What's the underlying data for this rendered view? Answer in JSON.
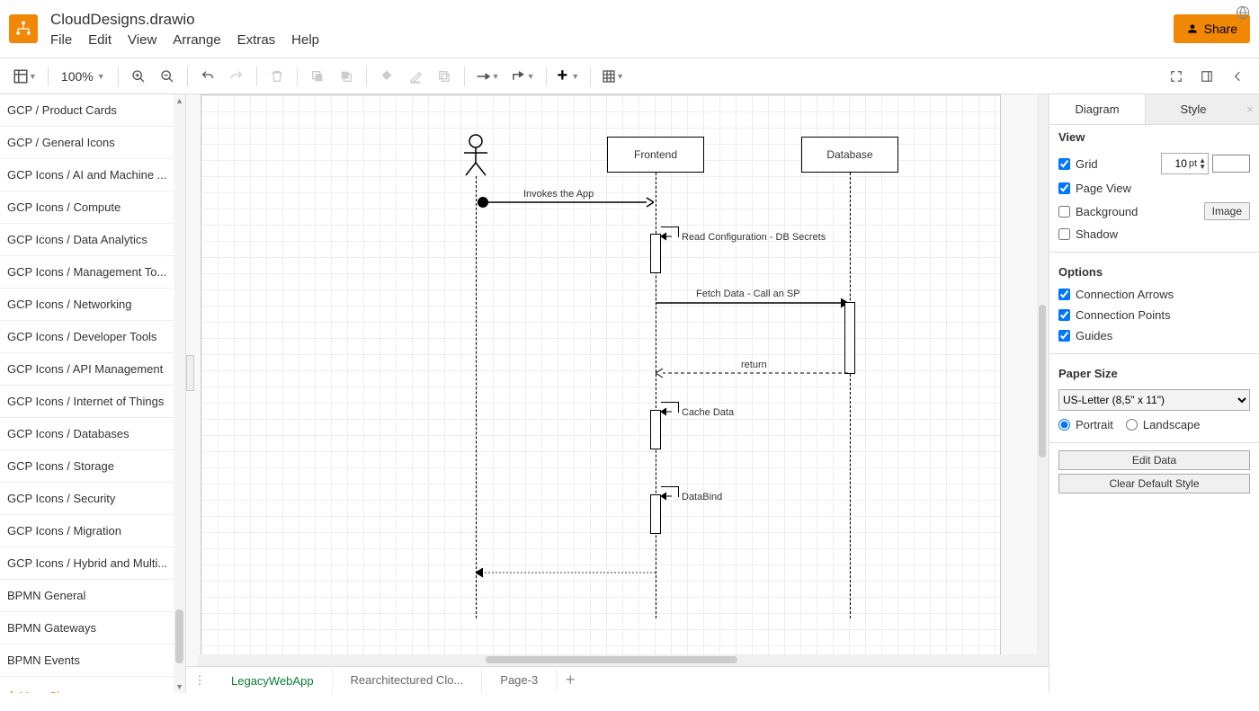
{
  "header": {
    "title": "CloudDesigns.drawio",
    "menus": [
      "File",
      "Edit",
      "View",
      "Arrange",
      "Extras",
      "Help"
    ],
    "share_label": "Share"
  },
  "toolbar": {
    "zoom": "100%"
  },
  "shapes": {
    "categories": [
      "GCP / Product Cards",
      "GCP / General Icons",
      "GCP Icons / AI and Machine ...",
      "GCP Icons / Compute",
      "GCP Icons / Data Analytics",
      "GCP Icons / Management To...",
      "GCP Icons / Networking",
      "GCP Icons / Developer Tools",
      "GCP Icons / API Management",
      "GCP Icons / Internet of Things",
      "GCP Icons / Databases",
      "GCP Icons / Storage",
      "GCP Icons / Security",
      "GCP Icons / Migration",
      "GCP Icons / Hybrid and Multi...",
      "BPMN General",
      "BPMN Gateways",
      "BPMN Events"
    ],
    "more_shapes": "More Shapes..."
  },
  "tabs": {
    "items": [
      "LegacyWebApp",
      "Rearchitectured Clo...",
      "Page-3"
    ],
    "active": 0
  },
  "right_panel": {
    "tabs": {
      "diagram": "Diagram",
      "style": "Style"
    },
    "view_heading": "View",
    "grid": "Grid",
    "grid_value": "10",
    "grid_unit": "pt",
    "page_view": "Page View",
    "background": "Background",
    "image_btn": "Image",
    "shadow": "Shadow",
    "options_heading": "Options",
    "conn_arrows": "Connection Arrows",
    "conn_points": "Connection Points",
    "guides": "Guides",
    "paper_heading": "Paper Size",
    "paper_value": "US-Letter (8,5\" x 11\")",
    "portrait": "Portrait",
    "landscape": "Landscape",
    "edit_data": "Edit Data",
    "clear_style": "Clear Default Style"
  },
  "diagram": {
    "frontend": "Frontend",
    "database": "Database",
    "msg1": "Invokes the App",
    "msg2": "Read Configuration - DB Secrets",
    "msg3": "Fetch Data - Call an SP",
    "msg4": "return",
    "msg5": "Cache Data",
    "msg6": "DataBind"
  }
}
